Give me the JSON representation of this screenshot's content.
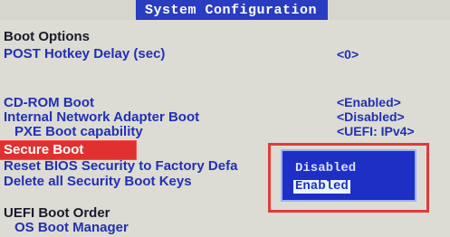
{
  "header": {
    "title": "System Configuration"
  },
  "menu": {
    "boot_options_title": "Boot Options",
    "post_hotkey_delay": {
      "label": "POST Hotkey Delay (sec)",
      "value": "<0>"
    },
    "cdrom_boot": {
      "label": "CD-ROM Boot",
      "value": "<Enabled>"
    },
    "internal_network_adapter_boot": {
      "label": "Internal Network Adapter Boot",
      "value": "<Disabled>"
    },
    "pxe_boot_capability": {
      "label": "PXE Boot capability",
      "value": "<UEFI: IPv4>"
    },
    "secure_boot": {
      "label": "Secure Boot"
    },
    "reset_bios_security": {
      "label": "Reset BIOS Security to Factory Defa"
    },
    "delete_secure_boot_keys": {
      "label": "Delete all Security Boot Keys"
    },
    "uefi_boot_order_title": "UEFI Boot Order",
    "os_boot_manager": {
      "label": "OS Boot Manager"
    }
  },
  "popup": {
    "options": [
      "Disabled",
      "Enabled"
    ],
    "selected": "Enabled"
  },
  "colors": {
    "background": "#dcdcd4",
    "menu_text": "#2230b4",
    "title_bar": "#2a3cc0",
    "highlight_red": "#e03030",
    "popup_bg": "#1d2fc4"
  }
}
